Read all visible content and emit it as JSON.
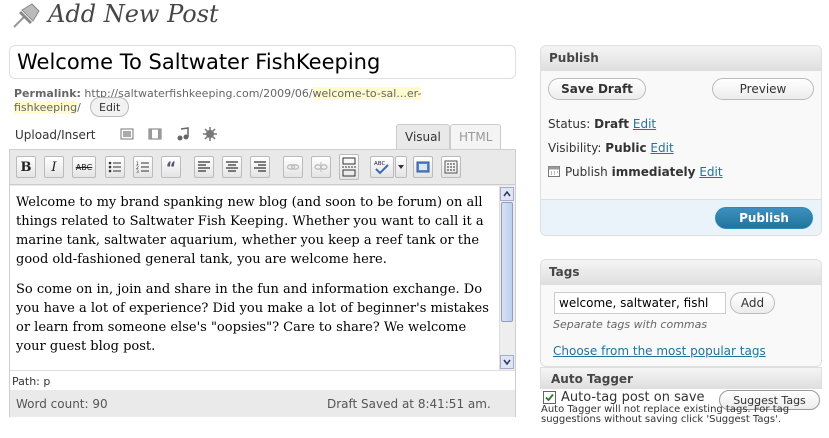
{
  "header": {
    "title": "Add New Post",
    "icon": "pushpin-icon"
  },
  "post": {
    "title": "Welcome To Saltwater FishKeeping",
    "permalink_label": "Permalink:",
    "permalink_base": "http://saltwaterfishkeeping.com/2009/06/",
    "permalink_slug": "welcome-to-sal...er-fishkeeping",
    "permalink_end": "/",
    "edit_label": "Edit"
  },
  "media": {
    "upload_label": "Upload/Insert",
    "icons": [
      "image-icon",
      "video-icon",
      "audio-icon",
      "media-icon"
    ]
  },
  "editor_tabs": {
    "visual": "Visual",
    "html": "HTML"
  },
  "toolbar": {
    "bold": "B",
    "italic": "I",
    "strike": "ABC",
    "bullets": "•",
    "numbers": "1.",
    "quote": "“",
    "spell": "ABC"
  },
  "content": {
    "paragraph_1": "Welcome to my brand spanking new blog (and soon to be forum) on all things related to Saltwater Fish Keeping.  Whether you want to call it a marine tank, saltwater aquarium, whether you keep a reef tank or the good old-fashioned general tank, you are welcome here.",
    "paragraph_2": "So come on in, join and share in the fun and information exchange.  Do you have a lot of experience?  Did you make a lot of beginner's mistakes or learn from someone else's \"oopsies\"?  Care to share? We welcome your guest blog post."
  },
  "path": "Path: p",
  "status_bar": {
    "word_count": "Word count: 90",
    "draft_saved": "Draft Saved at 8:41:51 am."
  },
  "publish": {
    "title": "Publish",
    "save_draft": "Save Draft",
    "preview": "Preview",
    "status_label": "Status:",
    "status_value": "Draft",
    "visibility_label": "Visibility:",
    "visibility_value": "Public",
    "publish_label": "Publish",
    "publish_value": "immediately",
    "edit": "Edit",
    "publish_button": "Publish"
  },
  "tags": {
    "title": "Tags",
    "input_value": "welcome, saltwater, fishl",
    "add_button": "Add",
    "hint": "Separate tags with commas",
    "popular_link": "Choose from the most popular tags"
  },
  "auto_tagger": {
    "title": "Auto Tagger",
    "checkbox_label": "Auto-tag post on save",
    "checked": true,
    "suggest_button": "Suggest Tags",
    "note": "Auto Tagger will not replace existing tags. For tag suggestions without saving click 'Suggest Tags'."
  },
  "colors": {
    "link": "#21759b",
    "publish_button": "#21759b",
    "highlight": "#fffbcc"
  }
}
